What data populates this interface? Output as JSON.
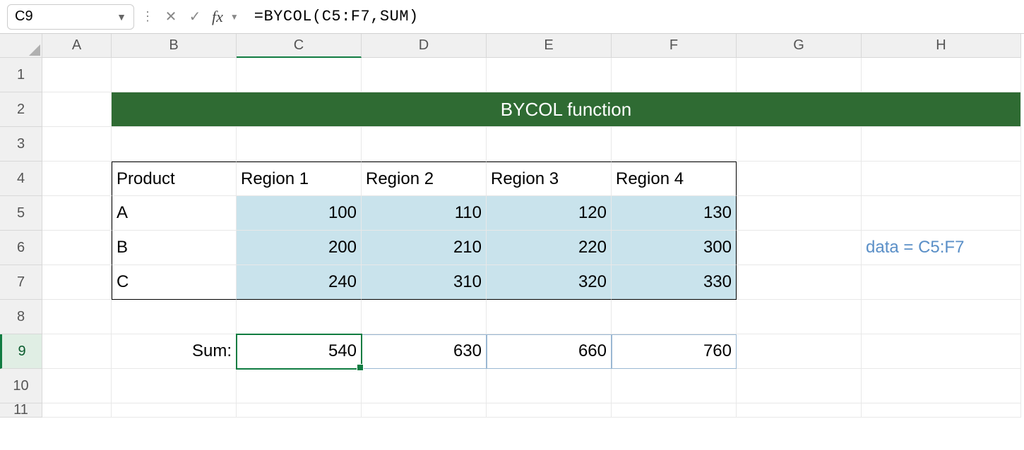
{
  "formula_bar": {
    "cell_ref": "C9",
    "formula": "=BYCOL(C5:F7,SUM)"
  },
  "columns": [
    "A",
    "B",
    "C",
    "D",
    "E",
    "F",
    "G",
    "H"
  ],
  "rows": [
    "1",
    "2",
    "3",
    "4",
    "5",
    "6",
    "7",
    "8",
    "9",
    "10",
    "11"
  ],
  "title": "BYCOL function",
  "table": {
    "header_product": "Product",
    "regions": [
      "Region 1",
      "Region 2",
      "Region 3",
      "Region 4"
    ],
    "products": [
      "A",
      "B",
      "C"
    ],
    "values": [
      [
        100,
        110,
        120,
        130
      ],
      [
        200,
        210,
        220,
        300
      ],
      [
        240,
        310,
        320,
        330
      ]
    ]
  },
  "sum_label": "Sum:",
  "sums": [
    540,
    630,
    660,
    760
  ],
  "note": "data = C5:F7",
  "chart_data": {
    "type": "table",
    "title": "BYCOL function",
    "columns": [
      "Product",
      "Region 1",
      "Region 2",
      "Region 3",
      "Region 4"
    ],
    "rows": [
      [
        "A",
        100,
        110,
        120,
        130
      ],
      [
        "B",
        200,
        210,
        220,
        300
      ],
      [
        "C",
        240,
        310,
        320,
        330
      ]
    ],
    "summary": {
      "label": "Sum:",
      "values": [
        540,
        630,
        660,
        760
      ]
    },
    "annotation": "data = C5:F7",
    "formula": "=BYCOL(C5:F7,SUM)"
  }
}
